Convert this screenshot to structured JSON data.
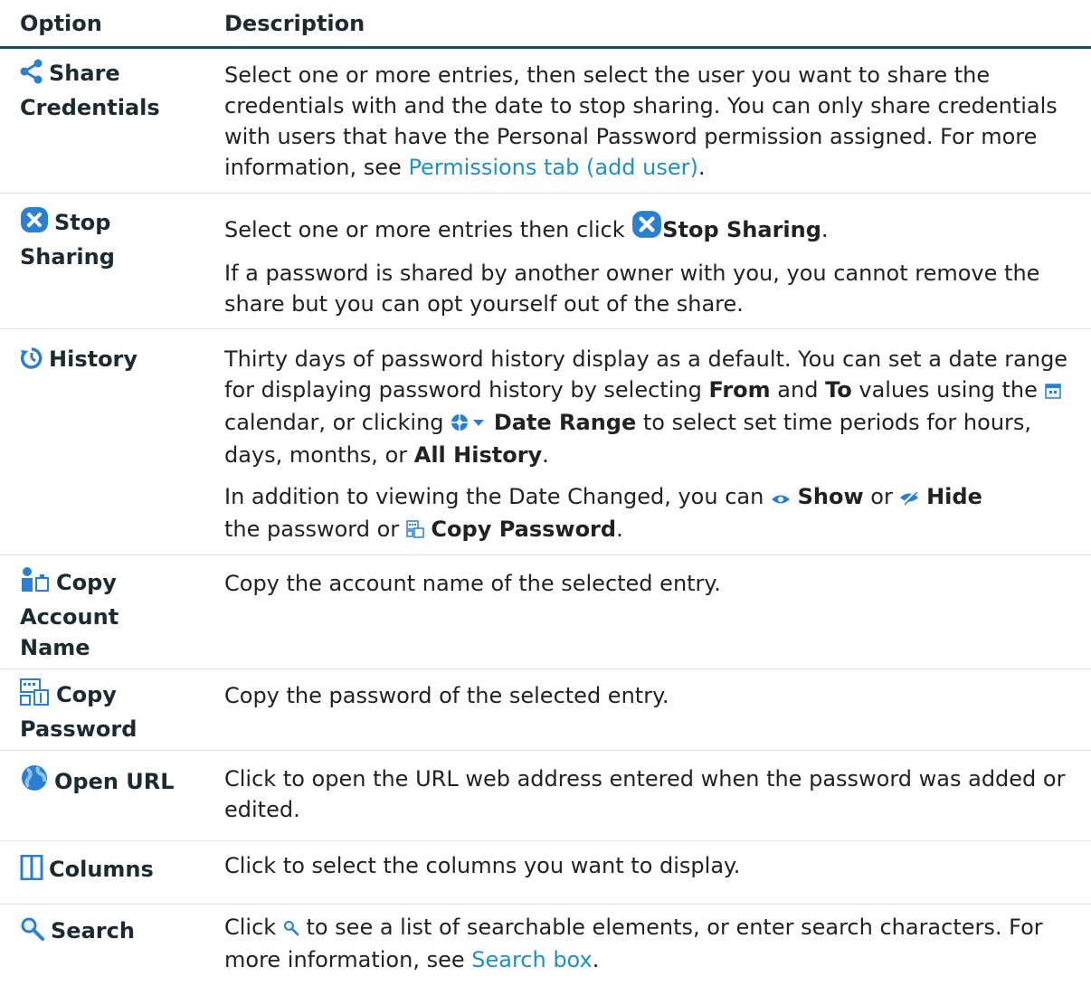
{
  "header": {
    "option": "Option",
    "description": "Description"
  },
  "rows": [
    {
      "icon": "share-icon",
      "option": [
        "Share",
        "Credentials"
      ],
      "desc_p1_a": "Select one or more entries, then select the user you want to share the credentials with and the date to stop sharing. You can only share credentials with users that have the Personal Password permission assigned. For more information, see ",
      "desc_p1_link": "Permissions tab (add user)",
      "desc_p1_b": "."
    },
    {
      "icon": "stop-sharing-icon",
      "option": [
        "Stop",
        "Sharing"
      ],
      "desc_p1_a": "Select one or more entries then click ",
      "desc_p1_bold": "Stop Sharing",
      "desc_p1_b": ".",
      "desc_p2": "If a password is shared by another owner with you, you cannot remove the share but you can opt yourself out of the share."
    },
    {
      "icon": "history-icon",
      "option": [
        "History"
      ],
      "desc_p1_a": "Thirty days of password history display as a default. You can set a date range for displaying password history by selecting ",
      "desc_p1_from": "From",
      "desc_p1_and": " and ",
      "desc_p1_to": "To",
      "desc_p1_b": " values using the ",
      "desc_p1_c": " calendar, or clicking ",
      "desc_p1_range": "Date Range",
      "desc_p1_d": " to select set time periods for hours, days, months, or ",
      "desc_p1_all": "All History",
      "desc_p1_e": ".",
      "desc_p2_a": "In addition to viewing the Date Changed, you can ",
      "desc_p2_show": "Show",
      "desc_p2_or": " or ",
      "desc_p2_hide": "Hide",
      "desc_p2_b": " the password or ",
      "desc_p2_copy": "Copy Password",
      "desc_p2_c": "."
    },
    {
      "icon": "copy-account-icon",
      "option": [
        "Copy",
        "Account",
        "Name"
      ],
      "desc": "Copy the account name of the selected entry."
    },
    {
      "icon": "copy-password-icon",
      "option": [
        "Copy",
        "Password"
      ],
      "desc": "Copy the password of the selected entry."
    },
    {
      "icon": "open-url-icon",
      "option": [
        "Open URL"
      ],
      "desc": "Click to open the URL web address entered when the password was added or edited."
    },
    {
      "icon": "columns-icon",
      "option": [
        "Columns"
      ],
      "desc": "Click to select the columns you want to display."
    },
    {
      "icon": "search-icon",
      "option": [
        "Search"
      ],
      "desc_a": "Click ",
      "desc_b": " to see a list of searchable elements, or enter search characters. For more information, see ",
      "desc_link": "Search box",
      "desc_c": "."
    }
  ],
  "colors": {
    "link": "#1e90c8",
    "header_rule": "#1a4f5d",
    "icon_blue": "#2a7fd0"
  }
}
